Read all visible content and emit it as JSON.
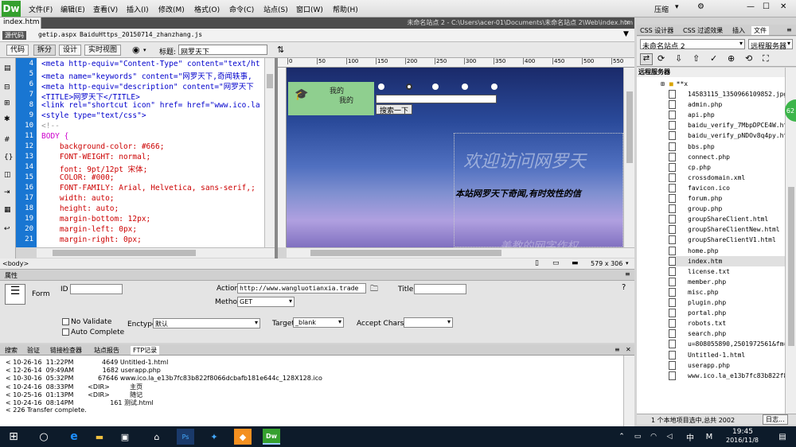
{
  "app": {
    "logo": "Dw"
  },
  "menu": [
    "文件(F)",
    "编辑(E)",
    "查看(V)",
    "插入(I)",
    "修改(M)",
    "格式(O)",
    "命令(C)",
    "站点(S)",
    "窗口(W)",
    "帮助(H)"
  ],
  "top_right": {
    "compress": "压缩"
  },
  "document": {
    "tab": "index.htm",
    "path": "未命名站点 2 - C:\\Users\\acer-01\\Documents\\未命名站点 2\\Web\\index.htm",
    "source_badge": "源代码",
    "related_files": [
      "getip.aspx",
      "BaiduHttps_20150714_zhanzhang.js"
    ]
  },
  "toolbar": {
    "code": "代码",
    "split": "拆分",
    "design": "设计",
    "live": "实时视图",
    "title_label": "标题:",
    "title_value": "网罗天下"
  },
  "code": {
    "line_numbers": [
      "4",
      "5",
      "6",
      "7",
      "8",
      "9",
      "10",
      "11",
      "12",
      "13",
      "14",
      "15",
      "16",
      "17",
      "18",
      "19",
      "20",
      "21"
    ],
    "lines": [
      "<meta http-equiv=\"Content-Type\" content=\"text/ht",
      "<meta name=\"keywords\" content=\"网罗天下,奇闻轶事,",
      "<meta http-equiv=\"description\" content=\"网罗天下",
      "<TITLE>网罗天下</TITLE>",
      "<link rel=\"shortcut icon\" href= href=\"www.ico.la",
      "<style type=\"text/css\">",
      "<!--",
      "BODY {",
      "    background-color: #666;",
      "    FONT-WEIGHT: normal;",
      "    font: 9pt/12pt 宋体;",
      "    COLOR: #000;",
      "    FONT-FAMILY: Arial, Helvetica, sans-serif,;",
      "    width: auto;",
      "    height: auto;",
      "    margin-bottom: 12px;",
      "    margin-left: 0px;",
      "    margin-right: 0px;"
    ]
  },
  "ruler_marks": [
    "0",
    "50",
    "100",
    "150",
    "200",
    "250",
    "300",
    "350",
    "400",
    "450",
    "500",
    "550"
  ],
  "design": {
    "logo_line1": "我的",
    "logo_line2": "我的",
    "search_button": "搜索一下",
    "welcome": "欢迎访问网罗天",
    "subtitle": "本站网罗天下奇闻,有时效性的信",
    "faint": "美教的网字作权"
  },
  "statusbar": {
    "tag": "<body>",
    "size": "579 x 306"
  },
  "properties": {
    "header": "属性",
    "form_label": "Form",
    "id_label": "ID",
    "action_label": "Action",
    "action_value": "http://www.wangluotianxia.trade",
    "method_label": "Method",
    "method_value": "GET",
    "title_label": "Title",
    "no_validate": "No Validate",
    "auto_complete": "Auto Complete",
    "enctype_label": "Enctype",
    "enctype_value": "默认",
    "target_label": "Target",
    "target_value": "_blank",
    "charset_label": "Accept Charset"
  },
  "results": {
    "tabs": [
      "搜索",
      "验证",
      "链接检查器",
      "站点报告",
      "FTP记录"
    ],
    "lines": [
      "< 10-26-16  11:22PM              4649 Untitled-1.html",
      "< 12-26-14  09:49AM              1682 userapp.php",
      "< 10-30-16  05:32PM            67646 www.ico.la_e13b7fc83b822f8066dcbafb181e644c_128X128.ico",
      "< 10-24-16  08:33PM       <DIR>          主页",
      "< 10-25-16  01:13PM       <DIR>          随记",
      "< 10-24-16  08:14PM                  161 测试.html",
      "< 226 Transfer complete."
    ]
  },
  "right_panel": {
    "tabs": [
      "CSS 设计器",
      "CSS 过滤效果",
      "插入",
      "文件"
    ],
    "site": "未命名站点 2",
    "server": "远程服务器",
    "list_header": "远程服务器",
    "root": "**x",
    "files": [
      "14583115_1350966109852.jpg",
      "admin.php",
      "api.php",
      "baidu_verify_7MbpDPCE4W.html",
      "baidu_verify_pNDOv8q4py.html",
      "bbs.php",
      "connect.php",
      "cp.php",
      "crossdomain.xml",
      "favicon.ico",
      "forum.php",
      "group.php",
      "groupShareClient.html",
      "groupShareClientNew.html",
      "groupShareClientV1.html",
      "home.php",
      "index.htm",
      "license.txt",
      "member.php",
      "misc.php",
      "plugin.php",
      "portal.php",
      "robots.txt",
      "search.php",
      "u=808055890,2501972561&fm=21",
      "Untitled-1.html",
      "userapp.php",
      "www.ico.la_e13b7fc83b822f80"
    ],
    "bottom_text": "1 个本地项目选中,总共 2002",
    "bottom_btn": "日志..."
  },
  "badge": "62",
  "taskbar": {
    "time": "19:45",
    "date": "2016/11/8",
    "ime": "中",
    "ime2": "M"
  }
}
